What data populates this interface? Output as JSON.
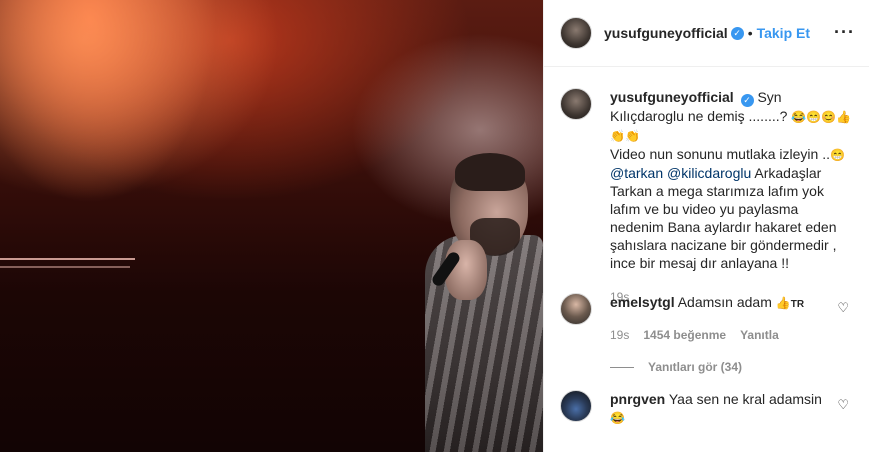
{
  "header": {
    "username": "yusufguneyofficial",
    "separator": "•",
    "follow_label": "Takip Et",
    "more_label": "···"
  },
  "caption": {
    "username": "yusufguneyofficial",
    "text_1": "Syn Kılıçdaroglu ne demiş ........?",
    "emojis_1": "😂😁😊👍👏👏",
    "text_2": "Video nun sonunu mutlaka izleyin ..",
    "emoji_2": "😁",
    "mention_1": "@tarkan",
    "mention_2": "@kilicdaroglu",
    "text_3": "Arkadaşlar Tarkan a mega starımıza lafım yok lafım ve bu video yu paylasma nedenim Bana aylardır hakaret eden şahıslara nacizane bir göndermedir , ince bir mesaj dır anlayana !!",
    "time": "19s"
  },
  "comments": [
    {
      "username": "emelsytgl",
      "text": "Adamsın adam",
      "emoji": "👍",
      "flag": "TR",
      "time": "19s",
      "likes": "1454 beğenme",
      "reply_label": "Yanıtla",
      "view_replies": "Yanıtları gör (34)"
    },
    {
      "username": "pnrgven",
      "text": "Yaa sen ne kral adamsin",
      "emoji": "😂"
    }
  ],
  "icons": {
    "heart": "♡",
    "verified": "✓"
  }
}
